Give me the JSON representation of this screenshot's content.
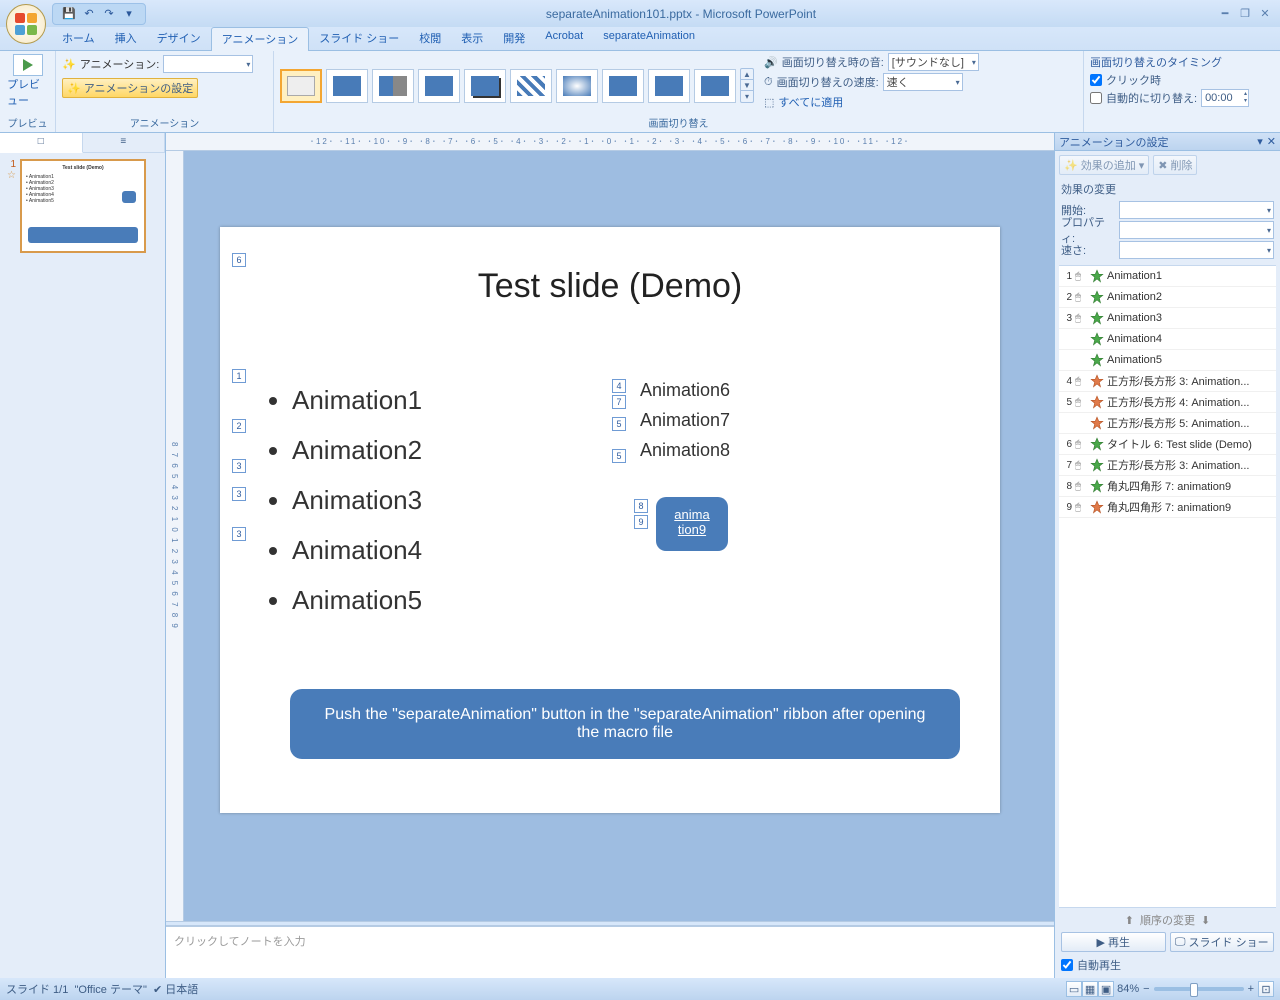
{
  "title": "separateAnimation101.pptx - Microsoft PowerPoint",
  "tabs": [
    "ホーム",
    "挿入",
    "デザイン",
    "アニメーション",
    "スライド ショー",
    "校閲",
    "表示",
    "開発",
    "Acrobat",
    "separateAnimation"
  ],
  "active_tab_index": 3,
  "ribbon": {
    "preview": {
      "label": "プレビュー",
      "group": "プレビュー"
    },
    "anim_group": {
      "label": "アニメーション",
      "dropdown_label": "アニメーション:",
      "dropdown_value": "",
      "settings_btn": "アニメーションの設定"
    },
    "trans_group": {
      "label": "画面切り替え",
      "sound_label": "画面切り替え時の音:",
      "sound_value": "[サウンドなし]",
      "speed_label": "画面切り替えの速度:",
      "speed_value": "速く",
      "apply_all": "すべてに適用"
    },
    "timing_group": {
      "title": "画面切り替えのタイミング",
      "onclick": "クリック時",
      "auto": "自動的に切り替え:",
      "auto_value": "00:00"
    }
  },
  "thumb": {
    "slide_number": "1",
    "star_text": "☆",
    "title": "Test slide (Demo)",
    "items": [
      "Animation1",
      "Animation2",
      "Animation3",
      "Animation4",
      "Animation5"
    ]
  },
  "ruler_h": "･12･ ･11･ ･10･ ･9･ ･8･ ･7･ ･6･ ･5･ ･4･ ･3･ ･2･ ･1･ ･0･ ･1･ ･2･ ･3･ ･4･ ･5･ ･6･ ･7･ ･8･ ･9･ ･10･ ･11･ ･12･",
  "ruler_v": "8 7 6 5 4 3 2 1 0 1 2 3 4 5 6 7 8 9",
  "slide": {
    "title": "Test slide (Demo)",
    "bullets": [
      "Animation1",
      "Animation2",
      "Animation3",
      "Animation4",
      "Animation5"
    ],
    "rbullets": [
      "Animation6",
      "Animation7",
      "Animation8"
    ],
    "shape_text": "anima\ntion9",
    "banner": "Push the \"separateAnimation\" button in the \"separateAnimation\" ribbon after opening the macro file",
    "tags": {
      "t6": "6",
      "l1": "1",
      "l2": "2",
      "l3": "3",
      "l4": "3",
      "l5": "3",
      "r4": "4",
      "r7": "7",
      "r5": "5",
      "r8": "5",
      "s8": "8",
      "s9": "9"
    }
  },
  "notes_placeholder": "クリックしてノートを入力",
  "pane": {
    "title": "アニメーションの設定",
    "add_effect": "効果の追加",
    "remove": "削除",
    "modify": "効果の変更",
    "start": "開始:",
    "property": "プロパティ:",
    "speed": "速さ:",
    "effects": [
      {
        "n": "1",
        "label": "Animation1",
        "type": "entrance"
      },
      {
        "n": "2",
        "label": "Animation2",
        "type": "entrance"
      },
      {
        "n": "3",
        "label": "Animation3",
        "type": "entrance"
      },
      {
        "n": "",
        "label": "Animation4",
        "type": "entrance"
      },
      {
        "n": "",
        "label": "Animation5",
        "type": "entrance"
      },
      {
        "n": "4",
        "label": "正方形/長方形 3: Animation...",
        "type": "exit"
      },
      {
        "n": "5",
        "label": "正方形/長方形 4: Animation...",
        "type": "exit"
      },
      {
        "n": "",
        "label": "正方形/長方形 5: Animation...",
        "type": "exit"
      },
      {
        "n": "6",
        "label": "タイトル 6: Test slide (Demo)",
        "type": "entrance"
      },
      {
        "n": "7",
        "label": "正方形/長方形 3: Animation...",
        "type": "entrance"
      },
      {
        "n": "8",
        "label": "角丸四角形 7: animation9",
        "type": "entrance"
      },
      {
        "n": "9",
        "label": "角丸四角形 7: animation9",
        "type": "exit"
      }
    ],
    "order": "順序の変更",
    "play": "再生",
    "slideshow": "スライド ショー",
    "autoplay": "自動再生"
  },
  "status": {
    "slide": "スライド 1/1",
    "theme": "\"Office テーマ\"",
    "lang": "日本語",
    "zoom": "84%"
  }
}
